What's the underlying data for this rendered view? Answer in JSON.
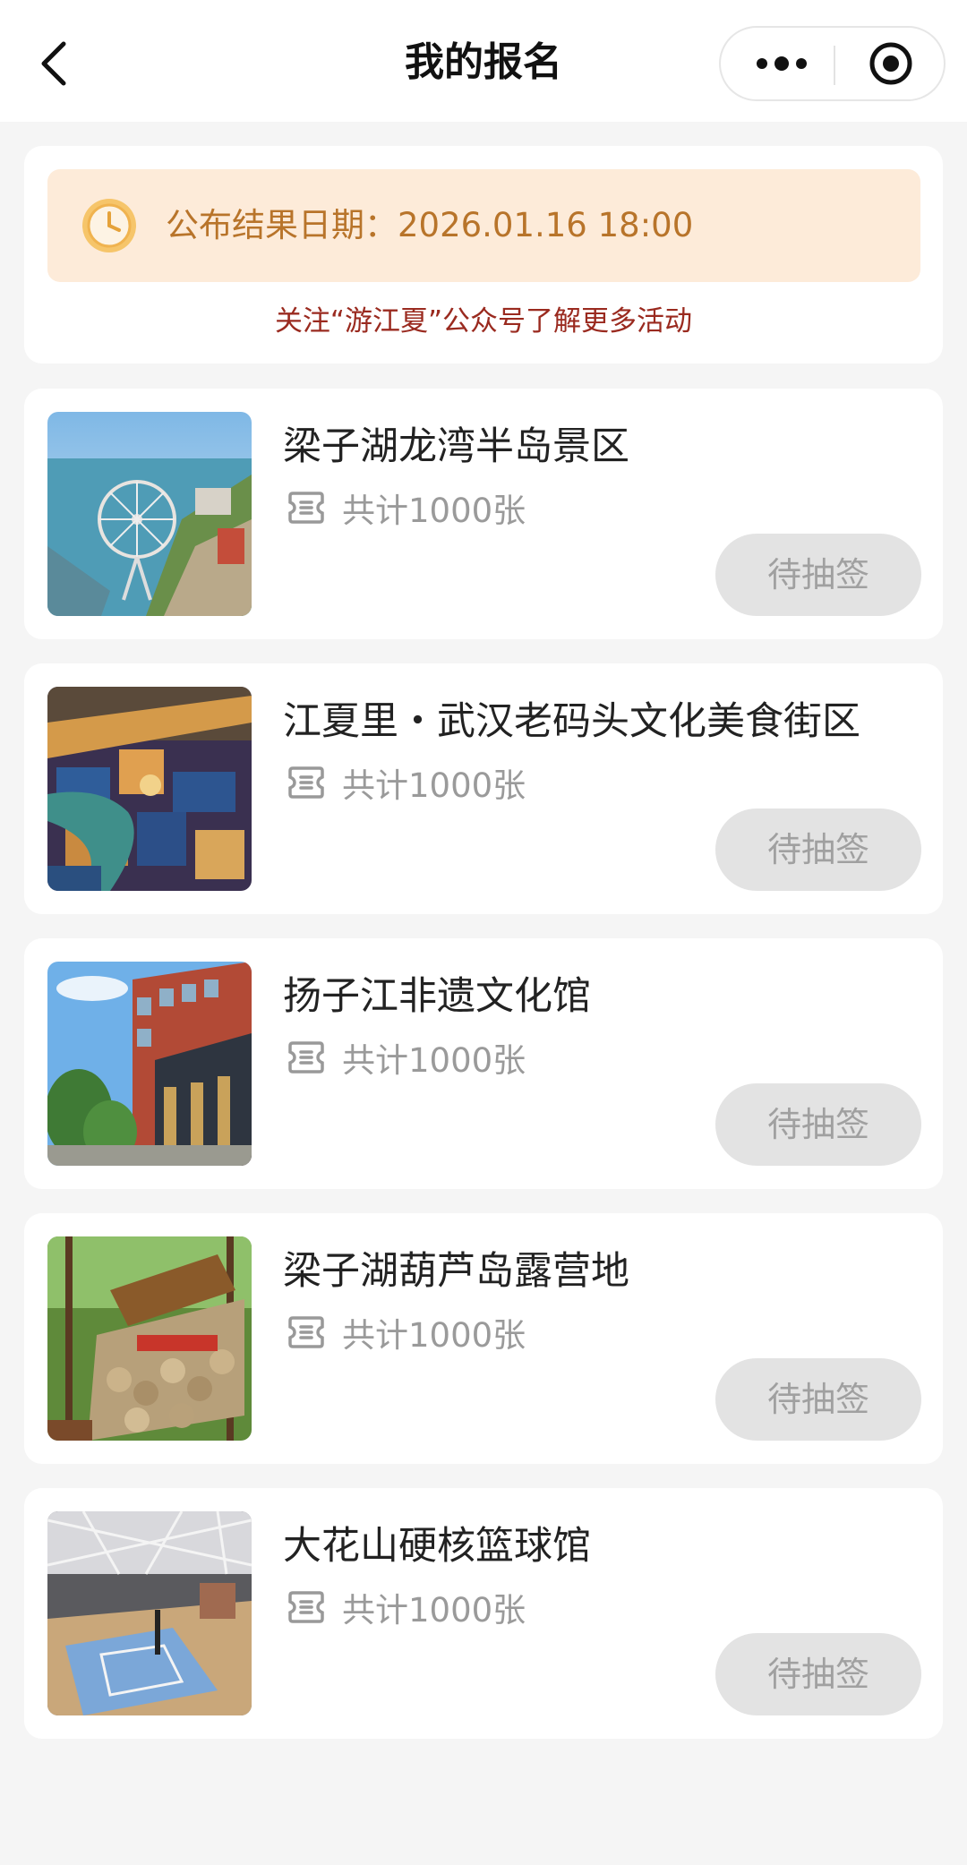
{
  "header": {
    "title": "我的报名",
    "back_icon": "chevron-left-icon",
    "more_icon": "more-dots-icon",
    "target_icon": "target-circle-icon"
  },
  "notice": {
    "date_text": "公布结果日期：2026.01.16 18:00",
    "follow_text": "关注“游江夏”公众号了解更多活动",
    "icon": "clock-icon",
    "colors": {
      "banner_bg": "#fdebd9",
      "date_text": "#b8742a",
      "follow_text": "#9a2a1f"
    }
  },
  "venues": [
    {
      "name": "梁子湖龙湾半岛景区",
      "tickets": "共计1000张",
      "status": "待抽签",
      "image": "lakeside-ferris-wheel-photo"
    },
    {
      "name": "江夏里・武汉老码头文化美食街区",
      "tickets": "共计1000张",
      "status": "待抽签",
      "image": "night-food-street-aerial-photo"
    },
    {
      "name": "扬子江非遗文化馆",
      "tickets": "共计1000张",
      "status": "待抽签",
      "image": "cultural-museum-building-photo"
    },
    {
      "name": "梁子湖葫芦岛露营地",
      "tickets": "共计1000张",
      "status": "待抽签",
      "image": "stone-sign-campsite-photo"
    },
    {
      "name": "大花山硬核篮球馆",
      "tickets": "共计1000张",
      "status": "待抽签",
      "image": "indoor-basketball-court-photo"
    }
  ]
}
